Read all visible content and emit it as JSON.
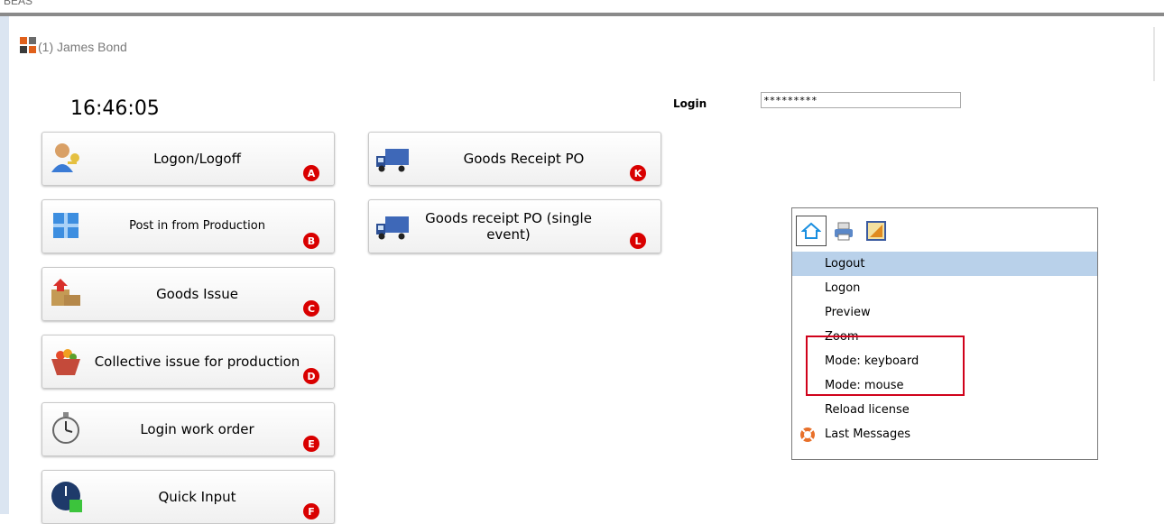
{
  "app": {
    "top_label": "BEAS",
    "window_title": "(1) James  Bond"
  },
  "clock": "16:46:05",
  "login": {
    "label": "Login",
    "value": "*********"
  },
  "tiles_left": [
    {
      "label": "Logon/Logoff",
      "badge": "A",
      "icon": "user-key-icon"
    },
    {
      "label": "Post in from Production",
      "badge": "B",
      "icon": "cube-icon"
    },
    {
      "label": "Goods Issue",
      "badge": "C",
      "icon": "boxes-icon"
    },
    {
      "label": "Collective issue for production",
      "badge": "D",
      "icon": "basket-icon"
    },
    {
      "label": "Login work order",
      "badge": "E",
      "icon": "stopwatch-icon"
    },
    {
      "label": "Quick Input",
      "badge": "F",
      "icon": "clock-icon"
    }
  ],
  "tiles_right": [
    {
      "label": "Goods Receipt PO",
      "badge": "K",
      "icon": "truck-icon"
    },
    {
      "label": "Goods receipt PO  (single event)",
      "badge": "L",
      "icon": "truck-icon"
    }
  ],
  "menu": {
    "toolbar": [
      "home-icon",
      "printer-icon",
      "settings-icon"
    ],
    "items": [
      {
        "label": "Logout",
        "selected": true
      },
      {
        "label": "Logon"
      },
      {
        "label": "Preview"
      },
      {
        "label": "Zoom"
      },
      {
        "label": "Mode: keyboard"
      },
      {
        "label": "Mode: mouse"
      },
      {
        "label": "Reload license"
      },
      {
        "label": "Last Messages",
        "icon": "lifebuoy-icon"
      }
    ]
  },
  "colors": {
    "badge": "#d90000",
    "selected": "#b9d1ea",
    "highlight": "#d0021b"
  }
}
